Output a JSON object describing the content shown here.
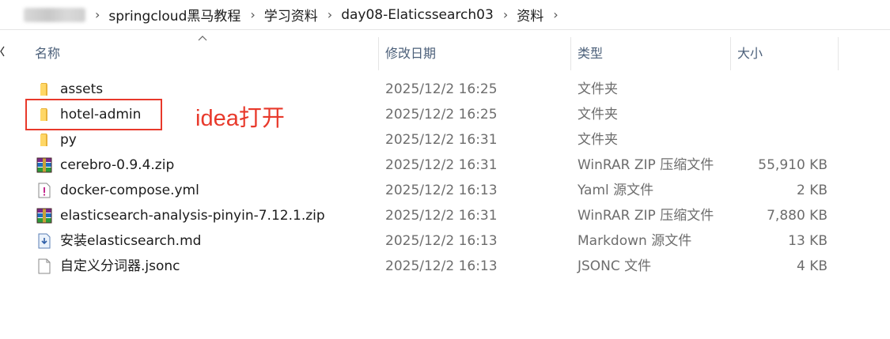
{
  "address_bar": {
    "crumbs": [
      "springcloud黑马教程",
      "day08-Elaticssearch03",
      "资料"
    ],
    "raw_crumbs": [
      "学习资料"
    ]
  },
  "columns": {
    "name": "名称",
    "modified": "修改日期",
    "type": "类型",
    "size": "大小"
  },
  "files": [
    {
      "icon": "folder-icon",
      "name": "assets",
      "modified": "2025/12/2 16:25",
      "type": "文件夹",
      "size": ""
    },
    {
      "icon": "folder-icon",
      "name": "hotel-admin",
      "modified": "2025/12/2 16:25",
      "type": "文件夹",
      "size": ""
    },
    {
      "icon": "folder-icon",
      "name": "py",
      "modified": "2025/12/2 16:31",
      "type": "文件夹",
      "size": ""
    },
    {
      "icon": "winrar-archive-icon",
      "name": "cerebro-0.9.4.zip",
      "modified": "2025/12/2 16:31",
      "type": "WinRAR ZIP 压缩文件",
      "size": "55,910 KB"
    },
    {
      "icon": "yaml-file-icon",
      "name": "docker-compose.yml",
      "modified": "2025/12/2 16:13",
      "type": "Yaml 源文件",
      "size": "2 KB"
    },
    {
      "icon": "winrar-archive-icon",
      "name": "elasticsearch-analysis-pinyin-7.12.1.zip",
      "modified": "2025/12/2 16:31",
      "type": "WinRAR ZIP 压缩文件",
      "size": "7,880 KB"
    },
    {
      "icon": "markdown-file-icon",
      "name": "安装elasticsearch.md",
      "modified": "2025/12/2 16:13",
      "type": "Markdown 源文件",
      "size": "13 KB"
    },
    {
      "icon": "blank-file-icon",
      "name": "自定义分词器.jsonc",
      "modified": "2025/12/2 16:13",
      "type": "JSONC 文件",
      "size": "4 KB"
    }
  ],
  "annotation": {
    "text": "idea打开",
    "color": "#e8392b"
  }
}
